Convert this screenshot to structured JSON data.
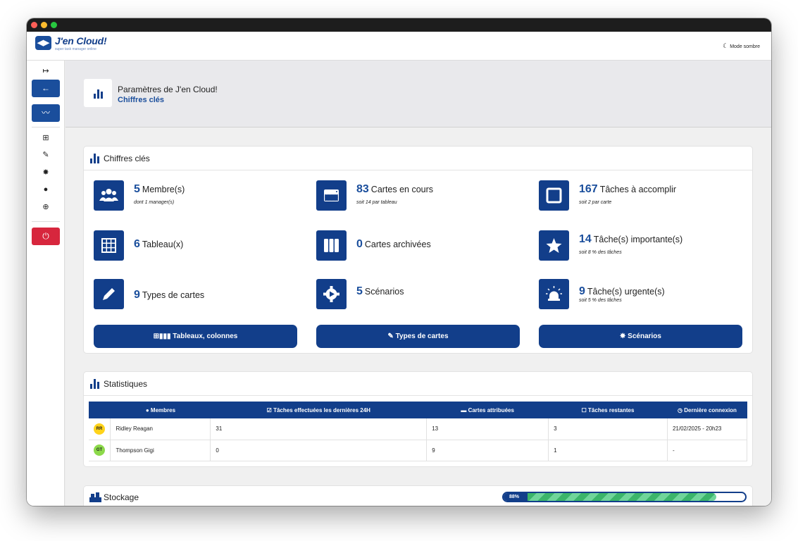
{
  "app": {
    "name": "J'en Cloud!",
    "tagline": "super task manager online",
    "logo_glyph": "◀▶",
    "dark_mode_label": "Mode sombre"
  },
  "sidebar": {
    "items": [
      {
        "name": "expand",
        "icon": "arrow-expand-icon",
        "glyph": "↦"
      },
      {
        "name": "back",
        "icon": "arrow-left-icon",
        "glyph": "←"
      },
      {
        "name": "stats",
        "icon": "chart-line-icon",
        "glyph": "〰"
      },
      {
        "name": "boards",
        "icon": "grid-icon",
        "glyph": "⊞"
      },
      {
        "name": "card-types",
        "icon": "pen-icon",
        "glyph": "✎"
      },
      {
        "name": "scenarios",
        "icon": "gear-icon",
        "glyph": "✸"
      },
      {
        "name": "members",
        "icon": "user-icon",
        "glyph": "●"
      },
      {
        "name": "help",
        "icon": "lifebuoy-icon",
        "glyph": "⊕"
      },
      {
        "name": "logout",
        "icon": "power-icon",
        "glyph": "⏻"
      }
    ]
  },
  "page_header": {
    "title": "Paramètres de J'en Cloud!",
    "subtitle": "Chiffres clés"
  },
  "key_figures": {
    "title": "Chiffres clés",
    "kpis": [
      {
        "id": "members",
        "icon": "users-icon",
        "number": "5",
        "label": "Membre(s)",
        "sub": "dont 1 manager(s)"
      },
      {
        "id": "cards-active",
        "icon": "card-icon",
        "number": "83",
        "label": "Cartes en cours",
        "sub": "soit 14 par tableau"
      },
      {
        "id": "tasks-todo",
        "icon": "checkbox-icon",
        "number": "167",
        "label": "Tâches à accomplir",
        "sub": "soit 2 par carte"
      },
      {
        "id": "boards",
        "icon": "table-icon",
        "number": "6",
        "label": "Tableau(x)",
        "sub": ""
      },
      {
        "id": "cards-archived",
        "icon": "columns-icon",
        "number": "0",
        "label": "Cartes archivées",
        "sub": ""
      },
      {
        "id": "tasks-important",
        "icon": "star-icon",
        "number": "14",
        "label": "Tâche(s) importante(s)",
        "sub": "soit 8 % des tâches"
      },
      {
        "id": "card-types",
        "icon": "pen-icon",
        "number": "9",
        "label": "Types de cartes",
        "sub": ""
      },
      {
        "id": "scenarios",
        "icon": "gear-play-icon",
        "number": "5",
        "label": "Scénarios",
        "sub": ""
      },
      {
        "id": "tasks-urgent",
        "icon": "alarm-icon",
        "number": "9",
        "label": "Tâche(s) urgente(s)",
        "sub": "soit 5 % des tâches"
      }
    ],
    "buttons": [
      {
        "id": "boards-columns",
        "icon": "grid-columns-icon",
        "label": "Tableaux, colonnes"
      },
      {
        "id": "card-types",
        "icon": "pen-icon",
        "label": "Types de cartes"
      },
      {
        "id": "scenarios",
        "icon": "gear-icon",
        "label": "Scénarios"
      }
    ]
  },
  "statistics": {
    "title": "Statistiques",
    "columns": [
      {
        "icon": "user-icon",
        "label": "Membres"
      },
      {
        "icon": "checkbox-checked-icon",
        "label": "Tâches effectuées les dernières 24H"
      },
      {
        "icon": "card-icon",
        "label": "Cartes attribuées"
      },
      {
        "icon": "checkbox-icon",
        "label": "Tâches restantes"
      },
      {
        "icon": "clock-icon",
        "label": "Dernière connexion"
      }
    ],
    "rows": [
      {
        "initials": "RR",
        "avatar_color": "#ffd31a",
        "name": "Ridley Reagan",
        "tasks_done_24h": "31",
        "cards_assigned": "13",
        "tasks_remaining": "3",
        "last_login": "21/02/2025 - 20h23"
      },
      {
        "initials": "GT",
        "avatar_color": "#8cd94a",
        "name": "Thompson Gigi",
        "tasks_done_24h": "0",
        "cards_assigned": "9",
        "tasks_remaining": "1",
        "last_login": "-"
      }
    ]
  },
  "storage": {
    "title": "Stockage",
    "percent_label": "88%",
    "percent": 88
  },
  "colors": {
    "primary": "#123e8a",
    "accent": "#1a4e9c",
    "danger": "#d7263d",
    "progress": "#3bb56a"
  }
}
